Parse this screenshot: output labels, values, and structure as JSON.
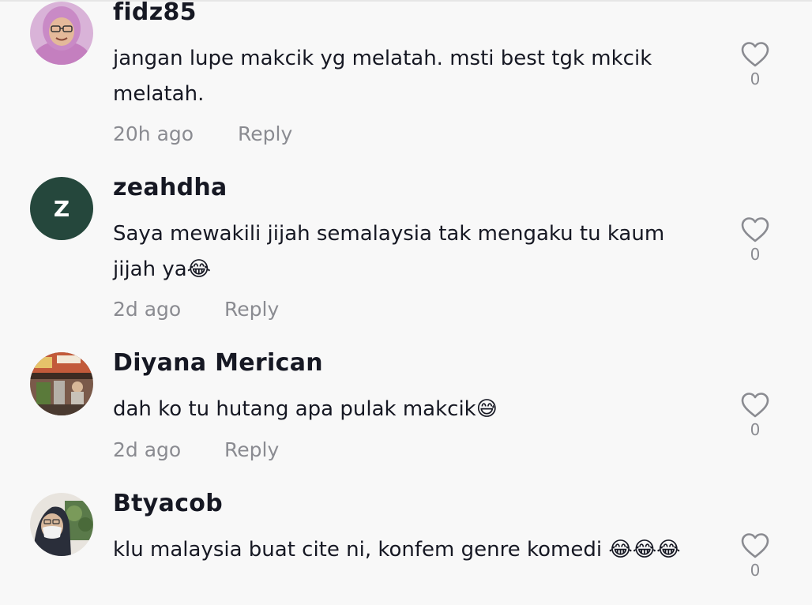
{
  "comments": [
    {
      "username": "fidz85",
      "text": "jangan lupe makcik yg melatah. msti best tgk mkcik melatah.",
      "emojis": "",
      "time": "20h ago",
      "reply_label": "Reply",
      "likes": "0",
      "avatar": "photo-woman-glasses-pink-hijab"
    },
    {
      "username": "zeahdha",
      "text": "Saya mewakili jijah semalaysia tak mengaku tu kaum jijah ya",
      "emojis": "😂",
      "time": "2d ago",
      "reply_label": "Reply",
      "likes": "0",
      "avatar": "letter-avatar",
      "avatar_letter": "Z",
      "avatar_color": "#25473c"
    },
    {
      "username": "Diyana Merican",
      "text": "dah ko tu hutang apa pulak makcik",
      "emojis": "😅",
      "time": "2d ago",
      "reply_label": "Reply",
      "likes": "0",
      "avatar": "photo-street-shop"
    },
    {
      "username": "Btyacob",
      "text": "klu malaysia buat cite ni, konfem genre komedi ",
      "emojis": "😂😂😂",
      "time": "",
      "reply_label": "",
      "likes": "0",
      "avatar": "photo-woman-mask-hijab"
    }
  ],
  "icons": {
    "like": "heart-outline-icon"
  },
  "colors": {
    "background": "#f8f8f8",
    "text": "#161823",
    "muted": "#8a8b91"
  }
}
